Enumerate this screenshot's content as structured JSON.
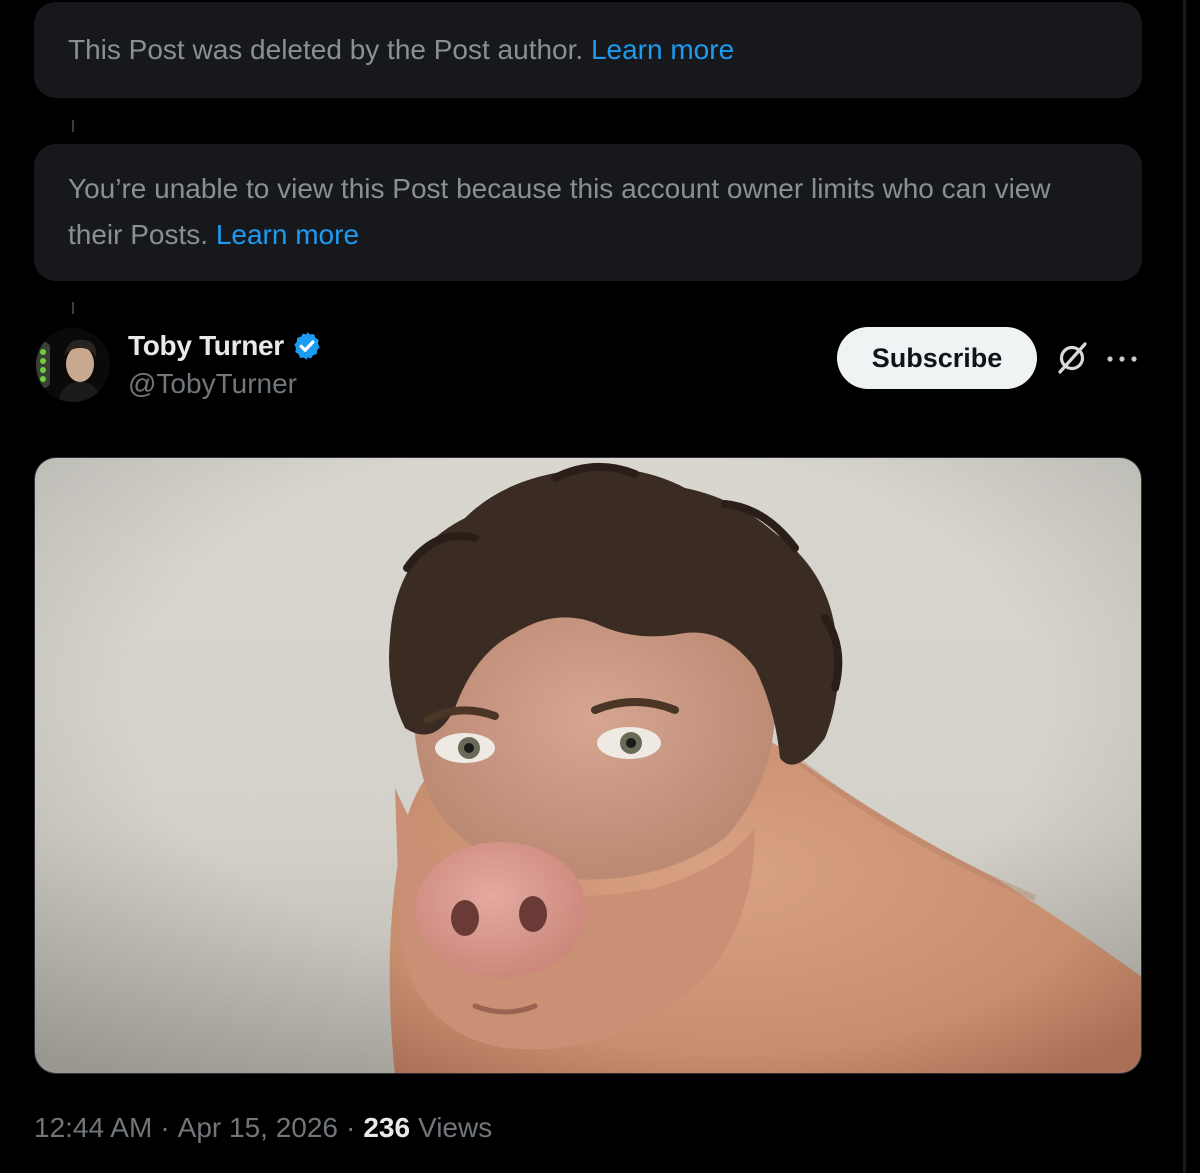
{
  "notices": [
    {
      "text": "This Post was deleted by the Post author.",
      "link": "Learn more"
    },
    {
      "text": "You’re unable to view this Post because this account owner limits who can view their Posts.",
      "link": "Learn more"
    }
  ],
  "post": {
    "author": {
      "name": "Toby Turner",
      "handle": "@TobyTurner",
      "verified": true,
      "avatar_icon": "avatar-icon"
    },
    "subscribe_label": "Subscribe",
    "actions": {
      "grok_icon": "grok-icon",
      "more_icon": "more-icon"
    },
    "media": {
      "type": "image"
    },
    "meta": {
      "time": "12:44 AM",
      "separator": "·",
      "date": "Apr 15, 2026",
      "views_count": "236",
      "views_label": "Views"
    }
  },
  "colors": {
    "background": "#000000",
    "card": "#16181c",
    "link": "#1d9bf0",
    "muted_text": "#71767b",
    "primary_text": "#e7e9ea",
    "verified": "#1d9bf0"
  }
}
